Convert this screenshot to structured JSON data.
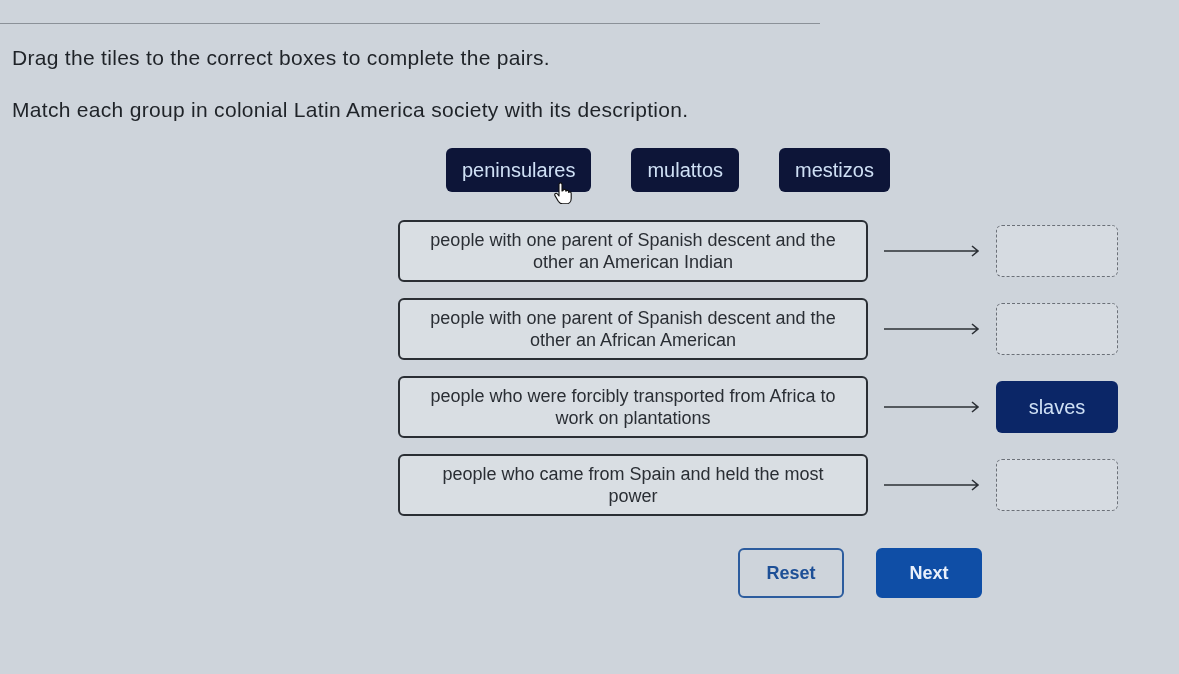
{
  "instructions": [
    "Drag the tiles to the correct boxes to complete the pairs.",
    "Match each group in colonial Latin America society with its description."
  ],
  "tiles": [
    {
      "label": "peninsulares",
      "hovered": true
    },
    {
      "label": "mulattos",
      "hovered": false
    },
    {
      "label": "mestizos",
      "hovered": false
    }
  ],
  "pairs": [
    {
      "description": "people with one parent of Spanish descent and the other an American Indian"
    },
    {
      "description": "people with one parent of Spanish descent and the other an African American"
    },
    {
      "description": "people who were forcibly transported from Africa to work on plantations",
      "answer": "slaves"
    },
    {
      "description": "people who came from Spain and held the most power"
    }
  ],
  "buttons": [
    {
      "label": "Reset",
      "kind": "secondary"
    },
    {
      "label": "Next",
      "kind": "primary"
    }
  ]
}
